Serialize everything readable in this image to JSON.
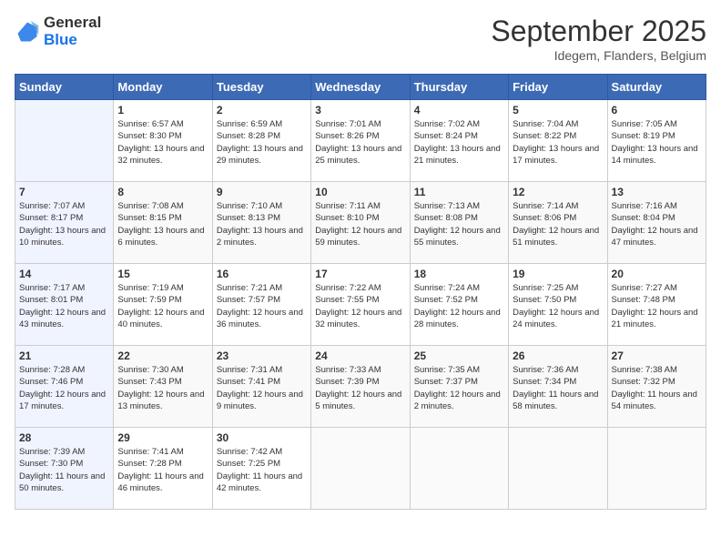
{
  "header": {
    "logo_general": "General",
    "logo_blue": "Blue",
    "month_year": "September 2025",
    "location": "Idegem, Flanders, Belgium"
  },
  "weekdays": [
    "Sunday",
    "Monday",
    "Tuesday",
    "Wednesday",
    "Thursday",
    "Friday",
    "Saturday"
  ],
  "weeks": [
    [
      {
        "num": "",
        "sunrise": "",
        "sunset": "",
        "daylight": ""
      },
      {
        "num": "1",
        "sunrise": "Sunrise: 6:57 AM",
        "sunset": "Sunset: 8:30 PM",
        "daylight": "Daylight: 13 hours and 32 minutes."
      },
      {
        "num": "2",
        "sunrise": "Sunrise: 6:59 AM",
        "sunset": "Sunset: 8:28 PM",
        "daylight": "Daylight: 13 hours and 29 minutes."
      },
      {
        "num": "3",
        "sunrise": "Sunrise: 7:01 AM",
        "sunset": "Sunset: 8:26 PM",
        "daylight": "Daylight: 13 hours and 25 minutes."
      },
      {
        "num": "4",
        "sunrise": "Sunrise: 7:02 AM",
        "sunset": "Sunset: 8:24 PM",
        "daylight": "Daylight: 13 hours and 21 minutes."
      },
      {
        "num": "5",
        "sunrise": "Sunrise: 7:04 AM",
        "sunset": "Sunset: 8:22 PM",
        "daylight": "Daylight: 13 hours and 17 minutes."
      },
      {
        "num": "6",
        "sunrise": "Sunrise: 7:05 AM",
        "sunset": "Sunset: 8:19 PM",
        "daylight": "Daylight: 13 hours and 14 minutes."
      }
    ],
    [
      {
        "num": "7",
        "sunrise": "Sunrise: 7:07 AM",
        "sunset": "Sunset: 8:17 PM",
        "daylight": "Daylight: 13 hours and 10 minutes."
      },
      {
        "num": "8",
        "sunrise": "Sunrise: 7:08 AM",
        "sunset": "Sunset: 8:15 PM",
        "daylight": "Daylight: 13 hours and 6 minutes."
      },
      {
        "num": "9",
        "sunrise": "Sunrise: 7:10 AM",
        "sunset": "Sunset: 8:13 PM",
        "daylight": "Daylight: 13 hours and 2 minutes."
      },
      {
        "num": "10",
        "sunrise": "Sunrise: 7:11 AM",
        "sunset": "Sunset: 8:10 PM",
        "daylight": "Daylight: 12 hours and 59 minutes."
      },
      {
        "num": "11",
        "sunrise": "Sunrise: 7:13 AM",
        "sunset": "Sunset: 8:08 PM",
        "daylight": "Daylight: 12 hours and 55 minutes."
      },
      {
        "num": "12",
        "sunrise": "Sunrise: 7:14 AM",
        "sunset": "Sunset: 8:06 PM",
        "daylight": "Daylight: 12 hours and 51 minutes."
      },
      {
        "num": "13",
        "sunrise": "Sunrise: 7:16 AM",
        "sunset": "Sunset: 8:04 PM",
        "daylight": "Daylight: 12 hours and 47 minutes."
      }
    ],
    [
      {
        "num": "14",
        "sunrise": "Sunrise: 7:17 AM",
        "sunset": "Sunset: 8:01 PM",
        "daylight": "Daylight: 12 hours and 43 minutes."
      },
      {
        "num": "15",
        "sunrise": "Sunrise: 7:19 AM",
        "sunset": "Sunset: 7:59 PM",
        "daylight": "Daylight: 12 hours and 40 minutes."
      },
      {
        "num": "16",
        "sunrise": "Sunrise: 7:21 AM",
        "sunset": "Sunset: 7:57 PM",
        "daylight": "Daylight: 12 hours and 36 minutes."
      },
      {
        "num": "17",
        "sunrise": "Sunrise: 7:22 AM",
        "sunset": "Sunset: 7:55 PM",
        "daylight": "Daylight: 12 hours and 32 minutes."
      },
      {
        "num": "18",
        "sunrise": "Sunrise: 7:24 AM",
        "sunset": "Sunset: 7:52 PM",
        "daylight": "Daylight: 12 hours and 28 minutes."
      },
      {
        "num": "19",
        "sunrise": "Sunrise: 7:25 AM",
        "sunset": "Sunset: 7:50 PM",
        "daylight": "Daylight: 12 hours and 24 minutes."
      },
      {
        "num": "20",
        "sunrise": "Sunrise: 7:27 AM",
        "sunset": "Sunset: 7:48 PM",
        "daylight": "Daylight: 12 hours and 21 minutes."
      }
    ],
    [
      {
        "num": "21",
        "sunrise": "Sunrise: 7:28 AM",
        "sunset": "Sunset: 7:46 PM",
        "daylight": "Daylight: 12 hours and 17 minutes."
      },
      {
        "num": "22",
        "sunrise": "Sunrise: 7:30 AM",
        "sunset": "Sunset: 7:43 PM",
        "daylight": "Daylight: 12 hours and 13 minutes."
      },
      {
        "num": "23",
        "sunrise": "Sunrise: 7:31 AM",
        "sunset": "Sunset: 7:41 PM",
        "daylight": "Daylight: 12 hours and 9 minutes."
      },
      {
        "num": "24",
        "sunrise": "Sunrise: 7:33 AM",
        "sunset": "Sunset: 7:39 PM",
        "daylight": "Daylight: 12 hours and 5 minutes."
      },
      {
        "num": "25",
        "sunrise": "Sunrise: 7:35 AM",
        "sunset": "Sunset: 7:37 PM",
        "daylight": "Daylight: 12 hours and 2 minutes."
      },
      {
        "num": "26",
        "sunrise": "Sunrise: 7:36 AM",
        "sunset": "Sunset: 7:34 PM",
        "daylight": "Daylight: 11 hours and 58 minutes."
      },
      {
        "num": "27",
        "sunrise": "Sunrise: 7:38 AM",
        "sunset": "Sunset: 7:32 PM",
        "daylight": "Daylight: 11 hours and 54 minutes."
      }
    ],
    [
      {
        "num": "28",
        "sunrise": "Sunrise: 7:39 AM",
        "sunset": "Sunset: 7:30 PM",
        "daylight": "Daylight: 11 hours and 50 minutes."
      },
      {
        "num": "29",
        "sunrise": "Sunrise: 7:41 AM",
        "sunset": "Sunset: 7:28 PM",
        "daylight": "Daylight: 11 hours and 46 minutes."
      },
      {
        "num": "30",
        "sunrise": "Sunrise: 7:42 AM",
        "sunset": "Sunset: 7:25 PM",
        "daylight": "Daylight: 11 hours and 42 minutes."
      },
      {
        "num": "",
        "sunrise": "",
        "sunset": "",
        "daylight": ""
      },
      {
        "num": "",
        "sunrise": "",
        "sunset": "",
        "daylight": ""
      },
      {
        "num": "",
        "sunrise": "",
        "sunset": "",
        "daylight": ""
      },
      {
        "num": "",
        "sunrise": "",
        "sunset": "",
        "daylight": ""
      }
    ]
  ]
}
